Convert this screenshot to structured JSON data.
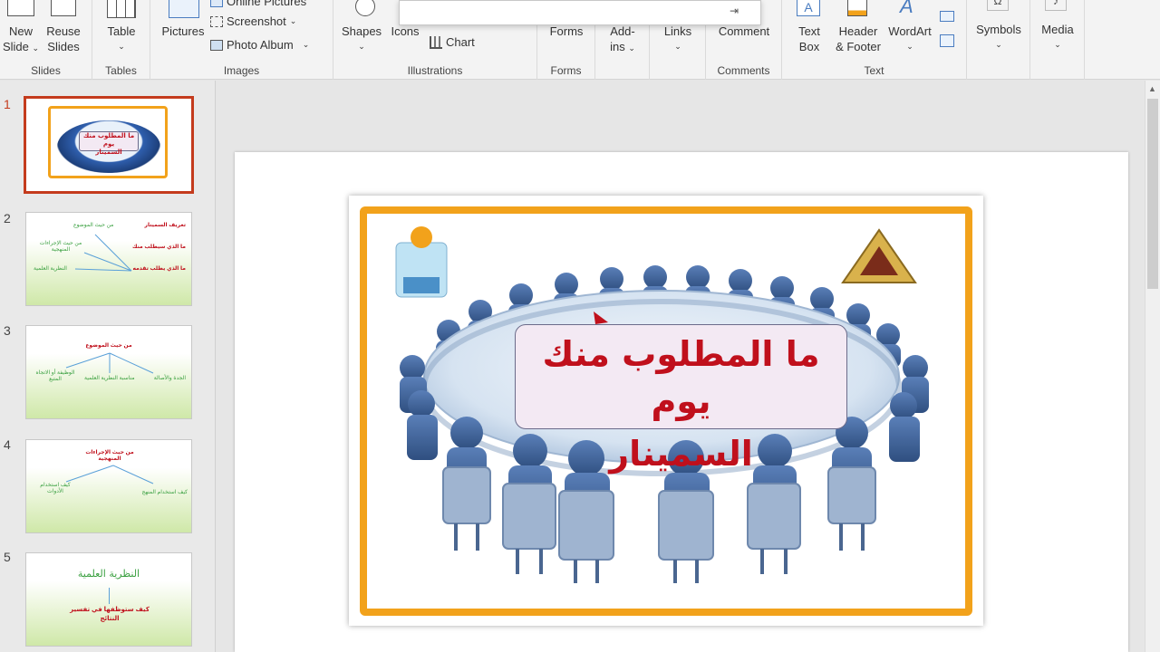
{
  "ribbon": {
    "groups": {
      "slides": "Slides",
      "tables": "Tables",
      "images": "Images",
      "illustrations": "Illustrations",
      "forms": "Forms",
      "comments": "Comments",
      "text": "Text"
    },
    "new_slide": [
      "New",
      "Slide"
    ],
    "reuse_slides": [
      "Reuse",
      "Slides"
    ],
    "table": "Table",
    "pictures": "Pictures",
    "online_pictures": "Online Pictures",
    "screenshot": "Screenshot",
    "photo_album": "Photo Album",
    "shapes": "Shapes",
    "icons": "Icons",
    "chart": "Chart",
    "forms_btn": "Forms",
    "addins": [
      "Add-",
      "ins"
    ],
    "links": "Links",
    "comment": "Comment",
    "text_box": [
      "Text",
      "Box"
    ],
    "header_footer": [
      "Header",
      "& Footer"
    ],
    "wordart": "WordArt",
    "symbols": "Symbols",
    "media": "Media"
  },
  "thumbnails": [
    {
      "num": "1",
      "texts": [
        "ما المطلوب منك يوم",
        "السمينار"
      ]
    },
    {
      "num": "2",
      "texts": [
        "تعريف السمينار",
        "ما الذي سيطلب منك",
        "ما الذي يطلب تقدمه",
        "من حيث الموضوع",
        "من حيث الإجراءات المنهجية",
        "النظرية العلمية"
      ]
    },
    {
      "num": "3",
      "texts": [
        "من حيث الموضوع",
        "الجدة والأصالة",
        "مناسبة النظرية العلمية",
        "الوظيفة أو الاتجاه المتبع"
      ]
    },
    {
      "num": "4",
      "texts": [
        "من حيث الإجراءات المنهجية",
        "كيف استخدام المنهج",
        "كيف استخدام الأدوات"
      ]
    },
    {
      "num": "5",
      "texts": [
        "النظرية العلمية",
        "كيف ستوظفها في تفسير النتائج"
      ]
    }
  ],
  "slide": {
    "title_line1": "ما المطلوب منك يوم",
    "title_line2": "السمينار"
  },
  "colors": {
    "accent": "#c43b1d",
    "frame_orange": "#f2a21b",
    "title_red": "#c0101c",
    "chair_blue": "#2f5fae"
  }
}
